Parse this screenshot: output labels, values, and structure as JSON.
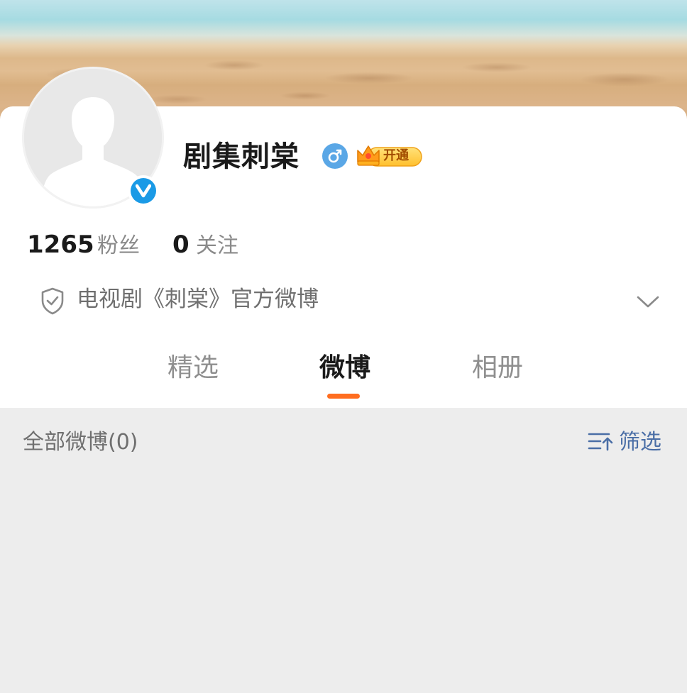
{
  "profile": {
    "name": "剧集刺棠",
    "followers_count": "1265",
    "followers_label": "粉丝",
    "following_count": "0",
    "following_label": "关注",
    "description": "电视剧《刺棠》官方微博",
    "vip_label": "开通",
    "gender_icon": "male-icon",
    "verified_icon": "verified-v-icon"
  },
  "tabs": [
    {
      "label": "精选",
      "active": false
    },
    {
      "label": "微博",
      "active": true
    },
    {
      "label": "相册",
      "active": false
    }
  ],
  "feed": {
    "count_label": "全部微博(0)",
    "filter_label": "筛选"
  },
  "colors": {
    "accent": "#ff6d1f",
    "verified_blue": "#1a9ae6",
    "link_blue": "#4a6ea6"
  }
}
